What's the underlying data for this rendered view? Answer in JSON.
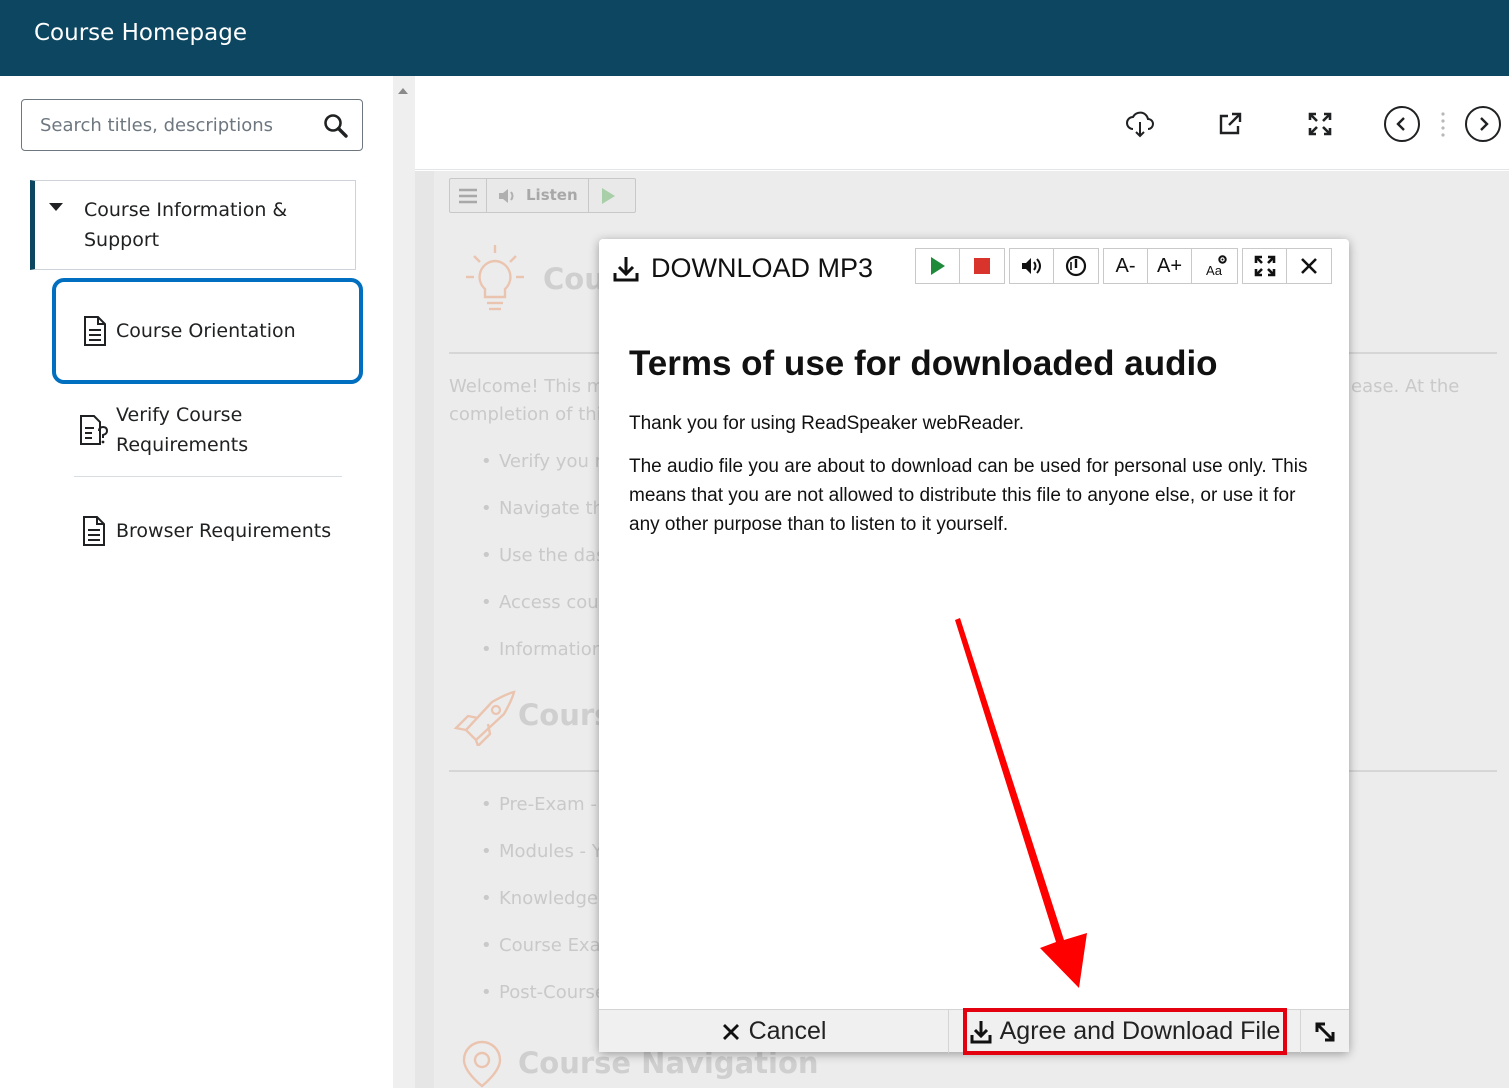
{
  "header": {
    "title": "Course Homepage"
  },
  "sidebar": {
    "search_placeholder": "Search titles, descriptions",
    "module": {
      "title": "Course Information & Support",
      "expanded": true
    },
    "topics": [
      {
        "label": "Course Orientation",
        "icon": "document-icon",
        "active": true
      },
      {
        "label": "Verify Course Requirements",
        "icon": "checklist-question-icon",
        "active": false
      },
      {
        "label": "Browser Requirements",
        "icon": "document-icon",
        "active": false
      }
    ]
  },
  "toolbar": {
    "icons": [
      "download-cloud-icon",
      "external-link-icon",
      "fullscreen-icon",
      "previous-icon",
      "next-icon"
    ]
  },
  "content": {
    "listen_label": "Listen",
    "heading1": "Cou",
    "intro_line1_left": "Welcome! This mo",
    "intro_line1_right": "ease. At the",
    "intro_line2_left": "completion of this",
    "bullets1": [
      "Verify you m",
      "Navigate th",
      "Use the das",
      "Access cour",
      "Information"
    ],
    "heading2": "Course",
    "bullets2": [
      "Pre-Exam -",
      "Modules - Y",
      "Knowledge",
      "Course Exa",
      "Post-Course"
    ],
    "heading3": "Course Navigation"
  },
  "dialog": {
    "title": "DOWNLOAD MP3",
    "font_smaller": "A-",
    "font_larger": "A+",
    "text_settings": "Aa",
    "heading": "Terms of use for downloaded audio",
    "para1": "Thank you for using ReadSpeaker webReader.",
    "para2": "The audio file you are about to download can be used for personal use only. This means that you are not allowed to distribute this file to anyone else, or use it for any other purpose than to listen to it yourself.",
    "cancel_label": "Cancel",
    "agree_label": "Agree and Download File"
  },
  "colors": {
    "header_bg": "#0c4661",
    "active_outline": "#006fbf",
    "highlight_red": "#e3000f",
    "play_green": "#1f8a3a",
    "stop_red": "#d9342b"
  }
}
